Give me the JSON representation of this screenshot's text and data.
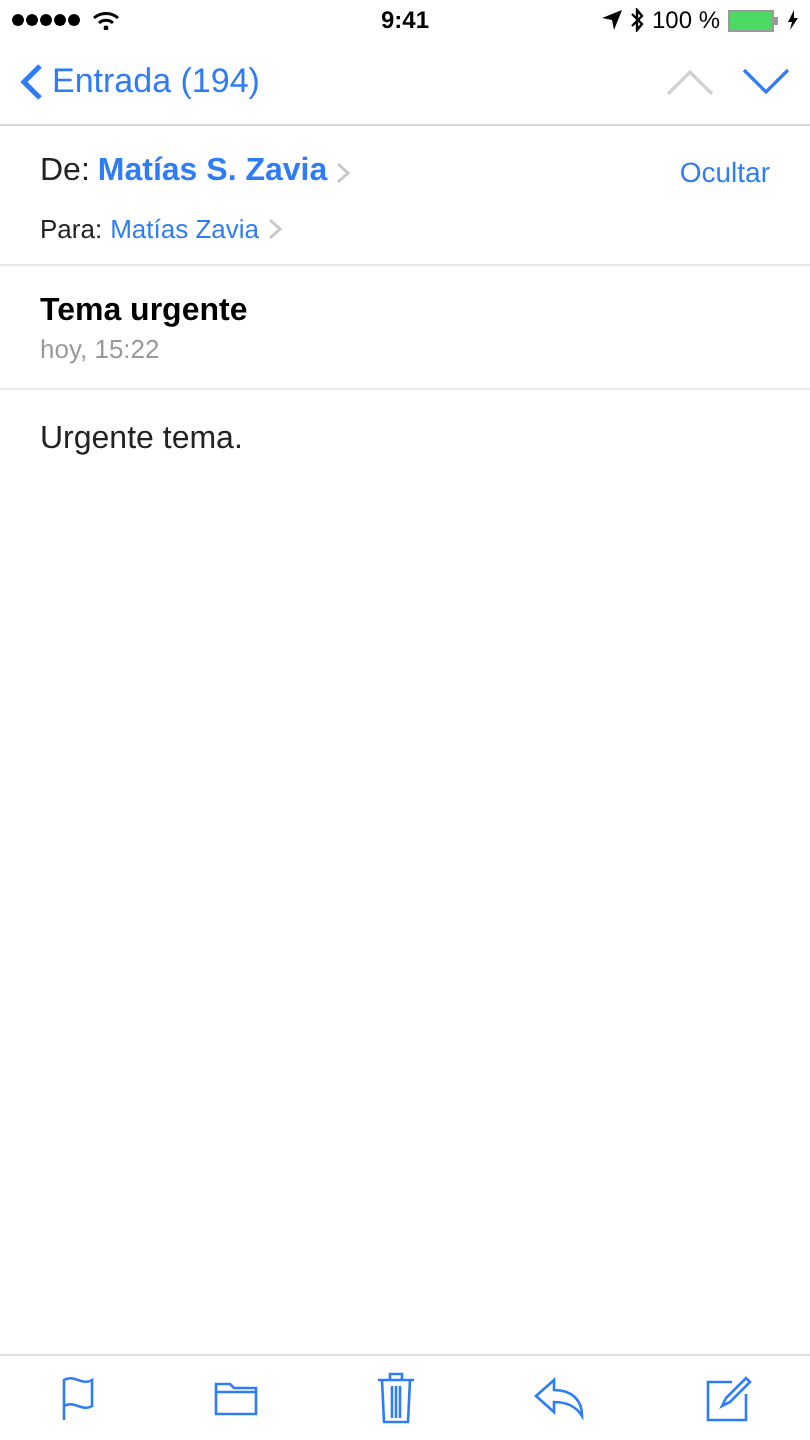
{
  "status_bar": {
    "time": "9:41",
    "battery": "100 %"
  },
  "nav": {
    "back": "Entrada (194)",
    "prev_disabled": true,
    "next_disabled": false
  },
  "header": {
    "from_label": "De:",
    "from": "Matías S. Zavia",
    "hide": "Ocultar",
    "to_label": "Para:",
    "to": "Matías Zavia"
  },
  "subject": "Tema urgente",
  "date": "hoy, 15:22",
  "body": "Urgente tema.",
  "toolbar": [
    {
      "kind": "flag"
    },
    {
      "kind": "folder"
    },
    {
      "kind": "trash"
    },
    {
      "kind": "reply"
    },
    {
      "kind": "compose"
    }
  ]
}
